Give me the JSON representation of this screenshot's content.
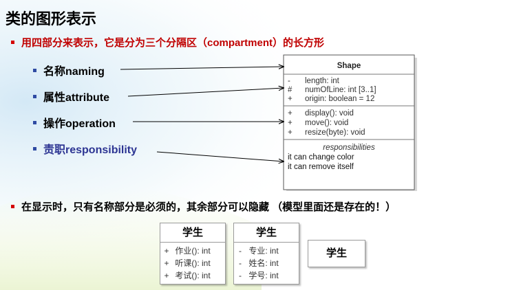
{
  "title": "类的图形表示",
  "bullet1": "用四部分来表示，它是分为三个分隔区（compartment）的长方形",
  "items": [
    {
      "label": "名称naming"
    },
    {
      "label": "属性attribute"
    },
    {
      "label": "操作operation"
    },
    {
      "label": "责职responsibility"
    }
  ],
  "shape": {
    "name": "Shape",
    "attributes": [
      {
        "vis": "-",
        "text": "length: int"
      },
      {
        "vis": "#",
        "text": "numOfLine: int [3..1]"
      },
      {
        "vis": "+",
        "text": "origin: boolean = 12"
      }
    ],
    "operations": [
      {
        "vis": "+",
        "text": "display(): void"
      },
      {
        "vis": "+",
        "text": "move(): void"
      },
      {
        "vis": "+",
        "text": "resize(byte): void"
      }
    ],
    "resp_title": "responsibilities",
    "responsibilities": [
      "it can change color",
      "it can remove itself"
    ]
  },
  "bullet2": "在显示时，只有名称部分是必须的，其余部分可以隐藏 （模型里面还是存在的！）",
  "student1": {
    "name": "学生",
    "rows": [
      {
        "vis": "+",
        "text": "作业(): int"
      },
      {
        "vis": "+",
        "text": "听课(): int"
      },
      {
        "vis": "+",
        "text": "考试(): int"
      }
    ]
  },
  "student2": {
    "name": "学生",
    "rows": [
      {
        "vis": "-",
        "text": "专业: int"
      },
      {
        "vis": "-",
        "text": "姓名: int"
      },
      {
        "vis": "-",
        "text": "学号: int"
      }
    ]
  },
  "student3": {
    "name": "学生"
  },
  "colors": {
    "red": "#c00000",
    "blue": "#2d3593",
    "bullet_red": "#d40000",
    "bullet_blue": "#2f4ba3"
  }
}
